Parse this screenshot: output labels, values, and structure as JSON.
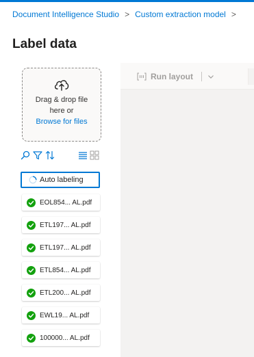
{
  "breadcrumb": {
    "items": [
      "Document Intelligence Studio",
      "Custom extraction model"
    ],
    "separator": ">"
  },
  "page": {
    "title": "Label data"
  },
  "upload": {
    "line1": "Drag & drop file",
    "line2": "here or",
    "browse_link": "Browse for files",
    "icon": "cloud-upload-icon"
  },
  "toolbar_icons": [
    "search-icon",
    "filter-icon",
    "sort-icon",
    "list-view-icon",
    "grid-view-icon"
  ],
  "auto_labeling": {
    "label": "Auto labeling"
  },
  "documents": [
    {
      "name": "EOL854... AL.pdf",
      "status": "labeled"
    },
    {
      "name": "ETL197... AL.pdf",
      "status": "labeled"
    },
    {
      "name": "ETL197... AL.pdf",
      "status": "labeled"
    },
    {
      "name": "ETL854... AL.pdf",
      "status": "labeled"
    },
    {
      "name": "ETL200... AL.pdf",
      "status": "labeled"
    },
    {
      "name": "EWL19... AL.pdf",
      "status": "labeled"
    },
    {
      "name": "100000... AL.pdf",
      "status": "labeled"
    }
  ],
  "canvas_toolbar": {
    "run_layout_label": "Run layout",
    "run_layout_enabled": false
  },
  "colors": {
    "accent": "#0078d4",
    "success": "#13a10e",
    "canvas": "#f3f2f1"
  }
}
